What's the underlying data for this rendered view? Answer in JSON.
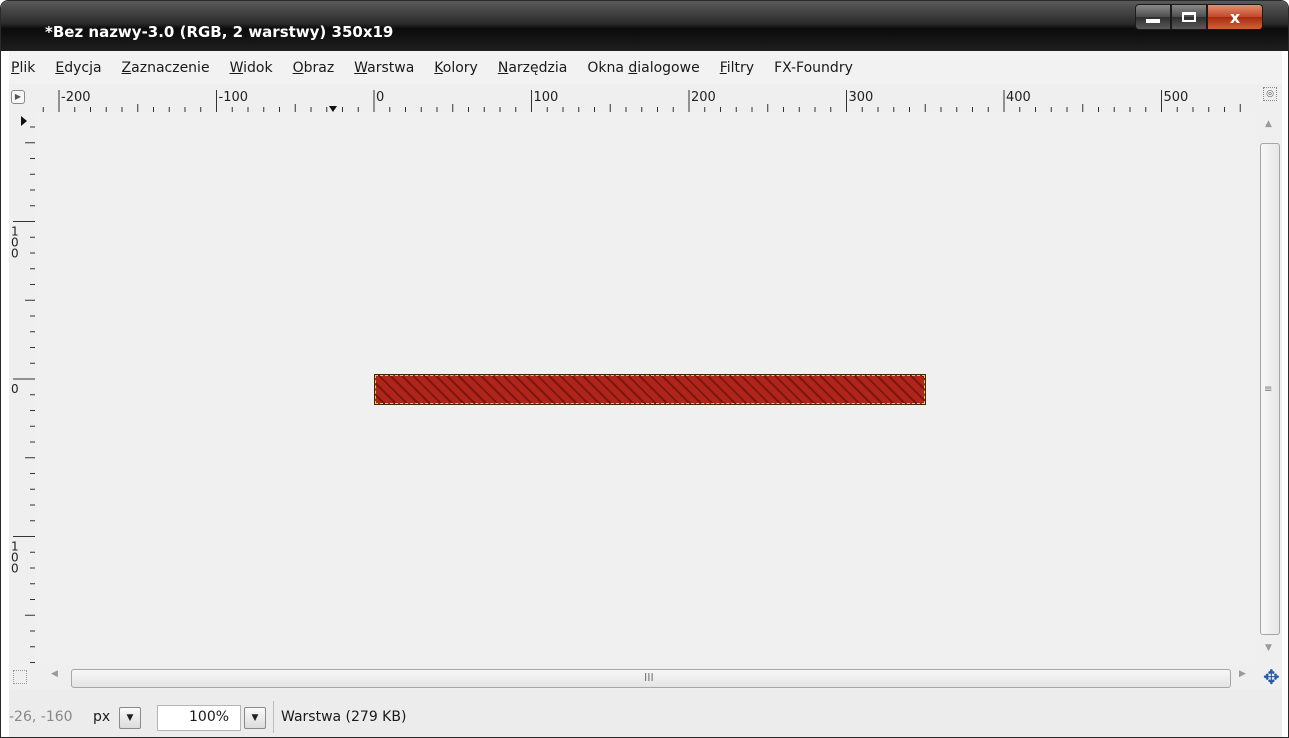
{
  "window": {
    "title": "*Bez nazwy-3.0 (RGB, 2 warstwy) 350x19",
    "close_glyph": "x"
  },
  "menubar": {
    "items": [
      {
        "accel": "P",
        "rest": "lik"
      },
      {
        "accel": "E",
        "rest": "dycja"
      },
      {
        "accel": "Z",
        "rest": "aznaczenie"
      },
      {
        "accel": "W",
        "rest": "idok"
      },
      {
        "accel": "O",
        "rest": "braz"
      },
      {
        "accel": "W",
        "rest": "arstwa"
      },
      {
        "accel": "K",
        "rest": "olory"
      },
      {
        "accel": "N",
        "rest": "arzędzia"
      },
      {
        "pre": "Okna ",
        "accel": "d",
        "rest": "ialogowe"
      },
      {
        "accel": "F",
        "rest": "iltry"
      },
      {
        "accel": "",
        "rest": "FX-Foundry"
      }
    ]
  },
  "rulers": {
    "horizontal_labels": [
      "-200",
      "-100",
      "0",
      "100",
      "200",
      "300",
      "400",
      "500"
    ],
    "vertical_labels": [
      "0",
      "100",
      "0",
      "100"
    ]
  },
  "canvas": {
    "background": "#f0f0f0",
    "layer_color": "#b02419",
    "selection_color": "#e8c542"
  },
  "icons": {
    "navigate": "move-cross-icon",
    "quick_mask": "quick-mask-icon",
    "zoom_fit": "zoom-icon",
    "menu_nav": "menu-arrow-icon"
  },
  "statusbar": {
    "coords": "-26, -160",
    "unit": "px",
    "zoom": "100%",
    "message": "Warstwa (279 KB)"
  }
}
